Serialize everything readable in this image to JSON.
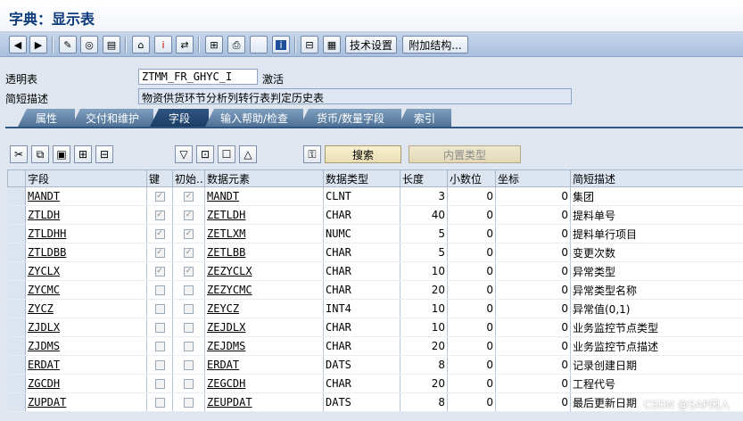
{
  "window": {
    "title": "字典：显示表"
  },
  "toolbar": {
    "icons": [
      "back-icon",
      "forward-icon",
      "pencil-glasses-icon",
      "where-used-icon",
      "object-list-icon",
      "hierarchy-icon",
      "info-red-icon",
      "navigate-icon",
      "layout-icon",
      "print-icon",
      "empty-icon",
      "info-blue-icon",
      "technical-icon",
      "structure-icon"
    ],
    "tech_settings": "技术设置",
    "append_struct": "附加结构..."
  },
  "header": {
    "transparent_label": "透明表",
    "table_name": "ZTMM_FR_GHYC_I",
    "status": "激活",
    "desc_label": "简短描述",
    "description": "物资供货环节分析列转行表判定历史表"
  },
  "tabs": [
    {
      "label": "属性"
    },
    {
      "label": "交付和维护"
    },
    {
      "label": "字段"
    },
    {
      "label": "输入帮助/检查"
    },
    {
      "label": "货币/数量字段"
    },
    {
      "label": "索引"
    }
  ],
  "panel": {
    "search_btn": "搜索",
    "builtin_btn": "内置类型"
  },
  "columns": [
    "字段",
    "键",
    "初始...",
    "数据元素",
    "数据类型",
    "长度",
    "小数位",
    "坐标",
    "简短描述"
  ],
  "rows": [
    {
      "field": "MANDT",
      "key": true,
      "init": true,
      "elem": "MANDT",
      "type": "CLNT",
      "len": "3",
      "dec": "0",
      "coord": "0",
      "desc": "集团"
    },
    {
      "field": "ZTLDH",
      "key": true,
      "init": true,
      "elem": "ZETLDH",
      "type": "CHAR",
      "len": "40",
      "dec": "0",
      "coord": "0",
      "desc": "提料单号"
    },
    {
      "field": "ZTLDHH",
      "key": true,
      "init": true,
      "elem": "ZETLXM",
      "type": "NUMC",
      "len": "5",
      "dec": "0",
      "coord": "0",
      "desc": "提料单行项目"
    },
    {
      "field": "ZTLDBB",
      "key": true,
      "init": true,
      "elem": "ZETLBB",
      "type": "CHAR",
      "len": "5",
      "dec": "0",
      "coord": "0",
      "desc": "变更次数"
    },
    {
      "field": "ZYCLX",
      "key": true,
      "init": true,
      "elem": "ZEZYCLX",
      "type": "CHAR",
      "len": "10",
      "dec": "0",
      "coord": "0",
      "desc": "异常类型"
    },
    {
      "field": "ZYCMC",
      "key": false,
      "init": false,
      "elem": "ZEZYCMC",
      "type": "CHAR",
      "len": "20",
      "dec": "0",
      "coord": "0",
      "desc": "异常类型名称"
    },
    {
      "field": "ZYCZ",
      "key": false,
      "init": false,
      "elem": "ZEYCZ",
      "type": "INT4",
      "len": "10",
      "dec": "0",
      "coord": "0",
      "desc": "异常值(0,1)"
    },
    {
      "field": "ZJDLX",
      "key": false,
      "init": false,
      "elem": "ZEJDLX",
      "type": "CHAR",
      "len": "10",
      "dec": "0",
      "coord": "0",
      "desc": "业务监控节点类型"
    },
    {
      "field": "ZJDMS",
      "key": false,
      "init": false,
      "elem": "ZEJDMS",
      "type": "CHAR",
      "len": "20",
      "dec": "0",
      "coord": "0",
      "desc": "业务监控节点描述"
    },
    {
      "field": "ERDAT",
      "key": false,
      "init": false,
      "elem": "ERDAT",
      "type": "DATS",
      "len": "8",
      "dec": "0",
      "coord": "0",
      "desc": "记录创建日期"
    },
    {
      "field": "ZGCDH",
      "key": false,
      "init": false,
      "elem": "ZEGCDH",
      "type": "CHAR",
      "len": "20",
      "dec": "0",
      "coord": "0",
      "desc": "工程代号"
    },
    {
      "field": "ZUPDAT",
      "key": false,
      "init": false,
      "elem": "ZEUPDAT",
      "type": "DATS",
      "len": "8",
      "dec": "0",
      "coord": "0",
      "desc": "最后更新日期"
    }
  ],
  "watermark": "CSDN @SAP闲人"
}
